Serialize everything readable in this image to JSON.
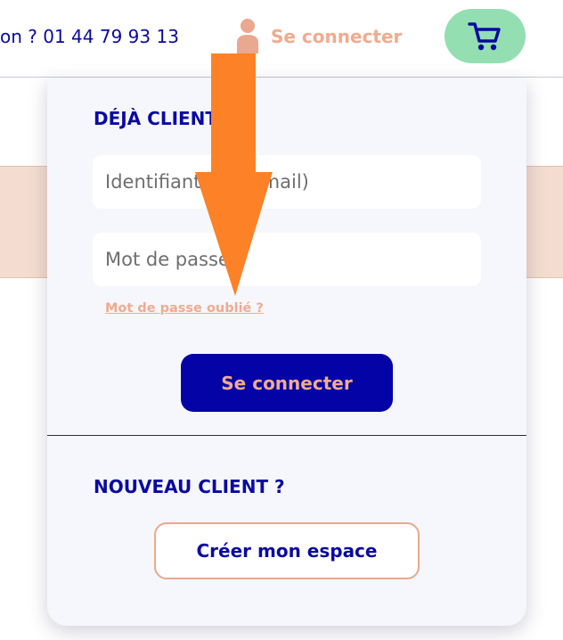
{
  "header": {
    "phone_text": "on ? 01 44 79 93 13",
    "login_label": "Se connecter",
    "icons": {
      "user": "user-icon",
      "cart": "cart-icon"
    },
    "colors": {
      "brand_blue": "#0a0aa0",
      "accent_peach": "#f0ab8e",
      "cart_green": "#93dfb1"
    }
  },
  "login_panel": {
    "existing_title": "DÉJÀ CLIENT",
    "identifier_placeholder": "Identifiant (ou e-mail)",
    "password_placeholder": "Mot de passe",
    "forgot_label": "Mot de passe oublié ?",
    "submit_label": "Se connecter",
    "new_title": "NOUVEAU CLIENT ?",
    "create_label": "Créer mon espace"
  },
  "overlay": {
    "annotation": "arrow-down",
    "color": "#fd8126"
  }
}
